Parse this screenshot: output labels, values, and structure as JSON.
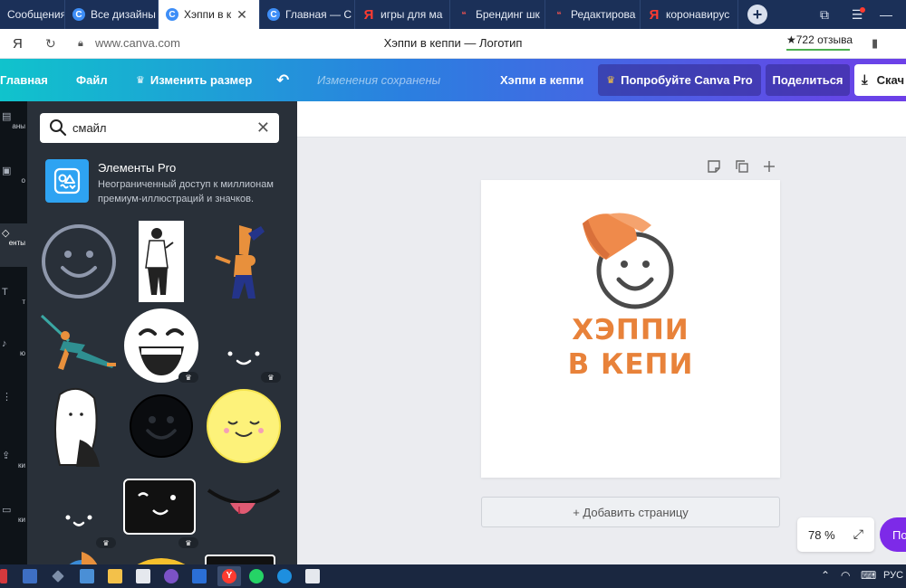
{
  "browser": {
    "tabs": [
      {
        "label": "Сообщения",
        "icon": "messages-icon",
        "active": false
      },
      {
        "label": "Все дизайны",
        "icon": "canva-icon",
        "active": false
      },
      {
        "label": "Хэппи в к",
        "icon": "canva-icon",
        "active": true
      },
      {
        "label": "Главная — С",
        "icon": "canva-icon",
        "active": false
      },
      {
        "label": "игры для ма",
        "icon": "yandex-icon",
        "active": false
      },
      {
        "label": "Брендинг шк",
        "icon": "brand-icon",
        "active": false
      },
      {
        "label": "Редактирова",
        "icon": "brand-icon",
        "active": false
      },
      {
        "label": "коронавирус",
        "icon": "yandex-icon",
        "active": false
      }
    ],
    "address": {
      "ya_logo": "Я",
      "url": "www.canva.com",
      "page_title": "Хэппи в кеппи — Логотип",
      "reviews": "★722 отзыва"
    }
  },
  "toolbar": {
    "home": "Главная",
    "file": "Файл",
    "resize": "Изменить размер",
    "saved": "Изменения сохранены",
    "design_name": "Хэппи в кеппи",
    "pro": "Попробуйте Canva Pro",
    "share": "Поделиться",
    "download": "Скач"
  },
  "rail": {
    "items": [
      "аны",
      "о",
      "енты",
      "т",
      "ю",
      "",
      "ки",
      "ки"
    ]
  },
  "panel": {
    "search": {
      "value": "смайл",
      "placeholder": "смайл"
    },
    "promo": {
      "title": "Элементы Pro",
      "description": "Неограниченный доступ к миллионам премиум-иллюстраций и значков."
    },
    "crown_symbol": "♛"
  },
  "canvas": {
    "logo_line1": "ХЭППИ",
    "logo_line2": "В КЕПИ",
    "add_page": "+ Добавить страницу",
    "zoom": "78 %",
    "help": "По"
  },
  "taskbar": {
    "language": "РУС"
  },
  "colors": {
    "accent_orange": "#e8823a",
    "canva_purple": "#7d2ae8",
    "panel_bg": "#293039"
  }
}
